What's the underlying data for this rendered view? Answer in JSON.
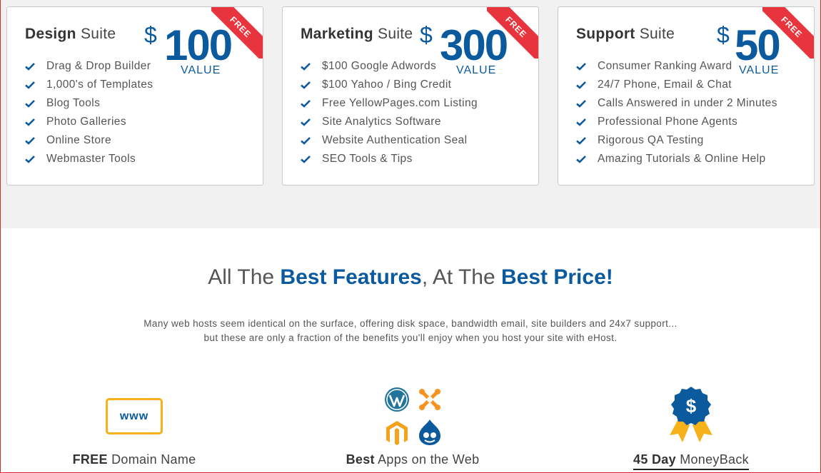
{
  "suites": [
    {
      "title_bold": "Design",
      "title_light": "Suite",
      "currency": "$",
      "amount": "100",
      "value_label": "VALUE",
      "ribbon": "FREE",
      "features": [
        "Drag & Drop Builder",
        "1,000's of Templates",
        "Blog Tools",
        "Photo Galleries",
        "Online Store",
        "Webmaster Tools"
      ]
    },
    {
      "title_bold": "Marketing",
      "title_light": "Suite",
      "currency": "$",
      "amount": "300",
      "value_label": "VALUE",
      "ribbon": "FREE",
      "features": [
        "$100 Google Adwords",
        "$100 Yahoo / Bing Credit",
        "Free YellowPages.com Listing",
        "Site Analytics Software",
        "Website Authentication Seal",
        "SEO Tools & Tips"
      ]
    },
    {
      "title_bold": "Support",
      "title_light": "Suite",
      "currency": "$",
      "amount": "50",
      "value_label": "VALUE",
      "ribbon": "FREE",
      "features": [
        "Consumer Ranking Award",
        "24/7 Phone, Email & Chat",
        "Calls Answered in under 2 Minutes",
        "Professional Phone Agents",
        "Rigorous QA Testing",
        "Amazing Tutorials & Online Help"
      ]
    }
  ],
  "headline": {
    "part1": "All The ",
    "bold1": "Best Features",
    "part2": ", At The ",
    "bold2": "Best Price",
    "end": "!"
  },
  "intro": {
    "line1": "Many web hosts seem identical on the surface, offering disk space, bandwidth email, site builders and 24x7 support...",
    "line2": "but these are only a fraction of the benefits you'll enjoy when you host your site with eHost."
  },
  "bottom_features": [
    {
      "bold": "FREE",
      "rest": " Domain Name",
      "icon_text": "www"
    },
    {
      "bold": "Best",
      "rest": " Apps on the Web"
    },
    {
      "bold": "45 Day",
      "rest": " MoneyBack",
      "badge_symbol": "$"
    }
  ],
  "colors": {
    "brand_blue": "#0b5a9e",
    "ribbon_red": "#e8343c",
    "accent_yellow": "#f5b21a"
  }
}
